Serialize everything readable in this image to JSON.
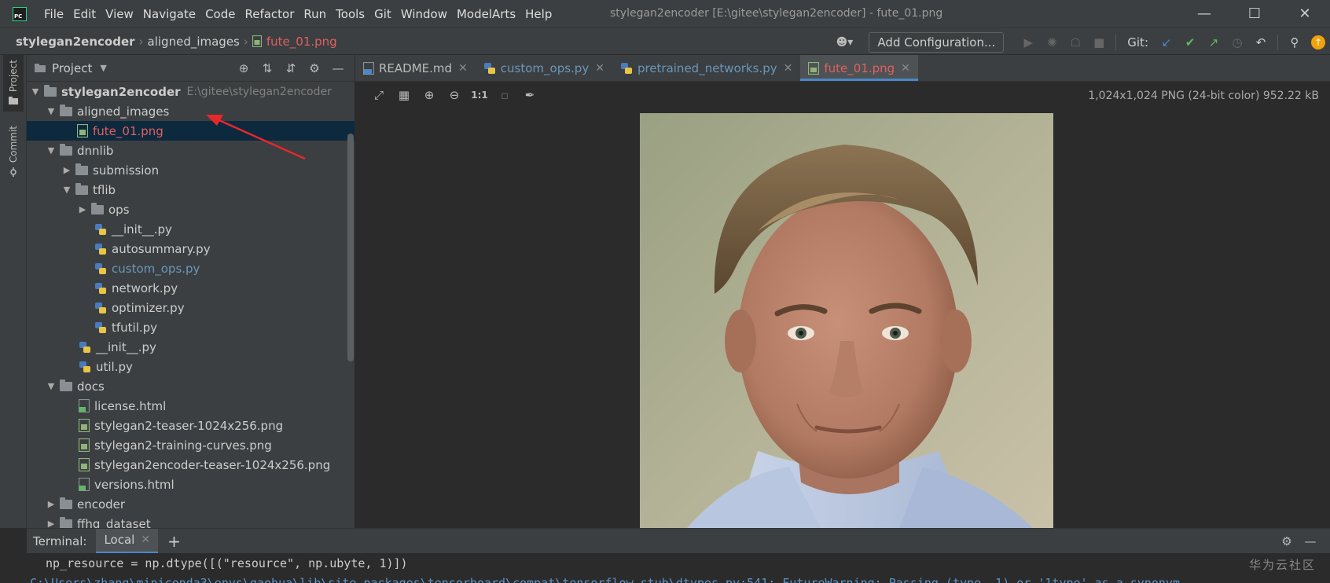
{
  "app": {
    "window_title": "stylegan2encoder [E:\\gitee\\stylegan2encoder] - fute_01.png",
    "logo_text": "PC",
    "menu": [
      "File",
      "Edit",
      "View",
      "Navigate",
      "Code",
      "Refactor",
      "Run",
      "Tools",
      "Git",
      "Window",
      "ModelArts",
      "Help"
    ]
  },
  "breadcrumb": {
    "project": "stylegan2encoder",
    "folder": "aligned_images",
    "file": "fute_01.png"
  },
  "toolbar": {
    "add_configuration": "Add Configuration...",
    "git_label": "Git:"
  },
  "left_stripe": {
    "project_tab": "Project",
    "commit_tab": "Commit"
  },
  "project_panel": {
    "title": "Project",
    "tree": [
      {
        "name": "stylegan2encoder",
        "path": "E:\\gitee\\stylegan2encoder"
      },
      {
        "name": "aligned_images"
      },
      {
        "name": "fute_01.png"
      },
      {
        "name": "dnnlib"
      },
      {
        "name": "submission"
      },
      {
        "name": "tflib"
      },
      {
        "name": "ops"
      },
      {
        "name": "__init__.py"
      },
      {
        "name": "autosummary.py"
      },
      {
        "name": "custom_ops.py"
      },
      {
        "name": "network.py"
      },
      {
        "name": "optimizer.py"
      },
      {
        "name": "tfutil.py"
      },
      {
        "name": "__init__.py"
      },
      {
        "name": "util.py"
      },
      {
        "name": "docs"
      },
      {
        "name": "license.html"
      },
      {
        "name": "stylegan2-teaser-1024x256.png"
      },
      {
        "name": "stylegan2-training-curves.png"
      },
      {
        "name": "stylegan2encoder-teaser-1024x256.png"
      },
      {
        "name": "versions.html"
      },
      {
        "name": "encoder"
      },
      {
        "name": "ffhq_dataset"
      }
    ]
  },
  "editor": {
    "tabs": [
      {
        "label": "README.md"
      },
      {
        "label": "custom_ops.py"
      },
      {
        "label": "pretrained_networks.py"
      },
      {
        "label": "fute_01.png"
      }
    ],
    "image_info": "1,024x1,024 PNG (24-bit color) 952.22 kB",
    "actual_size_label": "1:1"
  },
  "terminal": {
    "label": "Terminal:",
    "tab": "Local",
    "line1": "np_resource = np.dtype([(\"resource\", np.ubyte, 1)])",
    "line2": "C:\\Users\\zhang\\miniconda3\\envs\\gaohua\\lib\\site-packages\\tensorboard\\compat\\tensorflow_stub\\dtypes.py:541: FutureWarning: Passing (type, 1) or '1type' as a synonym",
    "watermark": "华为云社区"
  },
  "colors": {
    "accent": "#4a88c7",
    "modified_red": "#e06060",
    "selection": "#0d293e"
  }
}
